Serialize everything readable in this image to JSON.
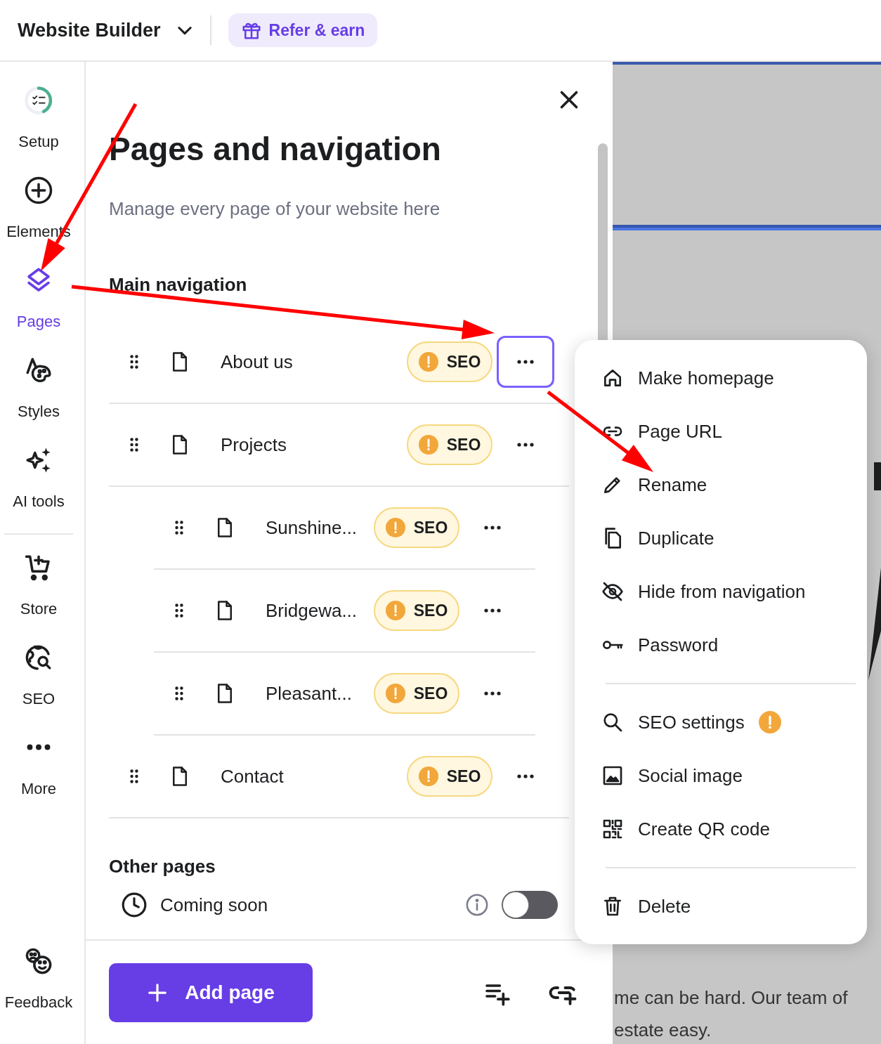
{
  "header": {
    "title": "Website Builder",
    "refer_button": "Refer & earn"
  },
  "sidebar": {
    "sections": [
      [
        {
          "label": "Setup",
          "kind": "setup",
          "selected": false
        },
        {
          "label": "Elements",
          "kind": "elements",
          "selected": false
        },
        {
          "label": "Pages",
          "kind": "pages",
          "selected": true
        },
        {
          "label": "Styles",
          "kind": "styles",
          "selected": false
        },
        {
          "label": "AI tools",
          "kind": "ai",
          "selected": false
        }
      ],
      [
        {
          "label": "Store",
          "kind": "store",
          "selected": false
        },
        {
          "label": "SEO",
          "kind": "seo",
          "selected": false
        },
        {
          "label": "More",
          "kind": "more",
          "selected": false
        }
      ]
    ],
    "footer_item": {
      "label": "Feedback",
      "kind": "feedback",
      "selected": false
    }
  },
  "panel": {
    "title": "Pages and navigation",
    "subtitle": "Manage every page of your website here",
    "main_navigation": {
      "heading": "Main navigation",
      "pages": [
        {
          "name": "About us",
          "badge": "SEO",
          "menu_open": true
        },
        {
          "name": "Projects",
          "badge": "SEO",
          "menu_open": false,
          "children": [
            {
              "name": "Sunshine...",
              "badge": "SEO",
              "menu_open": false
            },
            {
              "name": "Bridgewa...",
              "badge": "SEO",
              "menu_open": false
            },
            {
              "name": "Pleasant...",
              "badge": "SEO",
              "menu_open": false
            }
          ]
        },
        {
          "name": "Contact",
          "badge": "SEO",
          "menu_open": false
        }
      ]
    },
    "other_pages": {
      "heading": "Other pages",
      "items": [
        {
          "label": "Coming soon",
          "on": false
        }
      ]
    },
    "add_page_button": "Add page"
  },
  "page_menu": {
    "groups": [
      [
        {
          "label": "Make homepage",
          "kind": "home",
          "warning": false
        },
        {
          "label": "Page URL",
          "kind": "link",
          "warning": false
        },
        {
          "label": "Rename",
          "kind": "rename",
          "warning": false
        },
        {
          "label": "Duplicate",
          "kind": "duplicate",
          "warning": false
        },
        {
          "label": "Hide from navigation",
          "kind": "hide",
          "warning": false
        },
        {
          "label": "Password",
          "kind": "password",
          "warning": false
        }
      ],
      [
        {
          "label": "SEO settings",
          "kind": "seo",
          "warning": true
        },
        {
          "label": "Social image",
          "kind": "image",
          "warning": false
        },
        {
          "label": "Create QR code",
          "kind": "qr",
          "warning": false
        }
      ],
      [
        {
          "label": "Delete",
          "kind": "delete",
          "warning": false
        }
      ]
    ]
  },
  "preview": {
    "text_lines": [
      "me can be hard. Our team of",
      "estate easy."
    ]
  }
}
